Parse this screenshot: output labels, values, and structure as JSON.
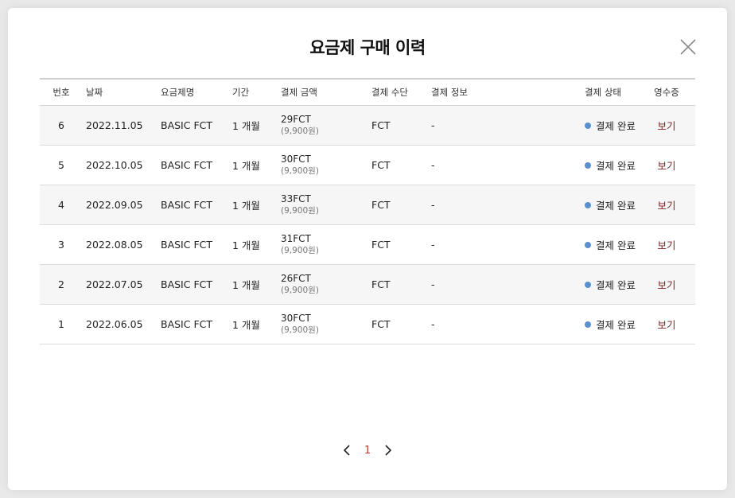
{
  "modal": {
    "title": "요금제 구매 이력"
  },
  "table": {
    "headers": {
      "no": "번호",
      "date": "날짜",
      "plan": "요금제명",
      "period": "기간",
      "amount": "결제 금액",
      "method": "결제 수단",
      "info": "결제 정보",
      "status": "결제 상태",
      "receipt": "영수증"
    },
    "rows": [
      {
        "no": "6",
        "date": "2022.11.05",
        "plan": "BASIC FCT",
        "period": "1 개월",
        "amount": "29FCT",
        "amount_krw": "(9,900원)",
        "method": "FCT",
        "info": "-",
        "status": "결제 완료",
        "receipt": "보기"
      },
      {
        "no": "5",
        "date": "2022.10.05",
        "plan": "BASIC FCT",
        "period": "1 개월",
        "amount": "30FCT",
        "amount_krw": "(9,900원)",
        "method": "FCT",
        "info": "-",
        "status": "결제 완료",
        "receipt": "보기"
      },
      {
        "no": "4",
        "date": "2022.09.05",
        "plan": "BASIC FCT",
        "period": "1 개월",
        "amount": "33FCT",
        "amount_krw": "(9,900원)",
        "method": "FCT",
        "info": "-",
        "status": "결제 완료",
        "receipt": "보기"
      },
      {
        "no": "3",
        "date": "2022.08.05",
        "plan": "BASIC FCT",
        "period": "1 개월",
        "amount": "31FCT",
        "amount_krw": "(9,900원)",
        "method": "FCT",
        "info": "-",
        "status": "결제 완료",
        "receipt": "보기"
      },
      {
        "no": "2",
        "date": "2022.07.05",
        "plan": "BASIC FCT",
        "period": "1 개월",
        "amount": "26FCT",
        "amount_krw": "(9,900원)",
        "method": "FCT",
        "info": "-",
        "status": "결제 완료",
        "receipt": "보기"
      },
      {
        "no": "1",
        "date": "2022.06.05",
        "plan": "BASIC FCT",
        "period": "1 개월",
        "amount": "30FCT",
        "amount_krw": "(9,900원)",
        "method": "FCT",
        "info": "-",
        "status": "결제 완료",
        "receipt": "보기"
      }
    ]
  },
  "pagination": {
    "current_page": "1"
  },
  "icons": {
    "close": "close-icon",
    "status_dot": "status-dot-icon",
    "prev": "chevron-left-icon",
    "next": "chevron-right-icon"
  },
  "colors": {
    "status_dot": "#5b8fd0",
    "receipt_link": "#7a1f1f",
    "current_page": "#c0392b",
    "row_shade": "#f6f6f6"
  }
}
